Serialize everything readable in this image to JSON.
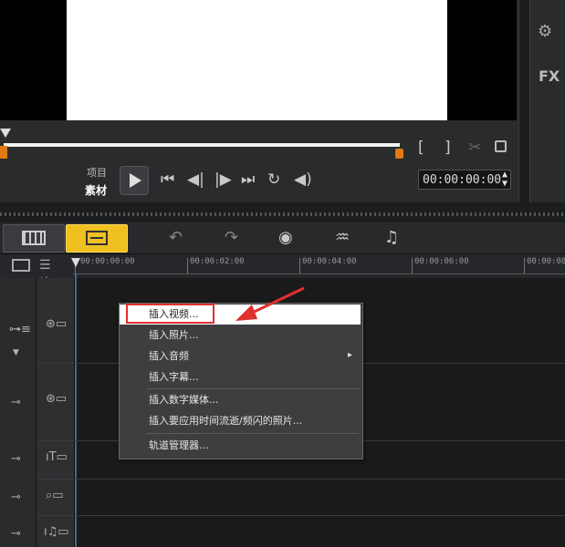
{
  "player": {
    "mode_project": "项目",
    "mode_clip": "素材",
    "timecode": "00:00:00:00",
    "mark_in": "[",
    "mark_out": "]"
  },
  "right_panel": {
    "fx_label": "FX"
  },
  "ruler": {
    "labels": [
      "00:00:00:00",
      "00:00:02:00",
      "00:00:04:00",
      "00:00:06:00",
      "00:00:08"
    ],
    "add_remove": "+/−"
  },
  "context_menu": {
    "items": [
      {
        "label": "插入视频..."
      },
      {
        "label": "插入照片..."
      },
      {
        "label": "插入音频"
      },
      {
        "label": "插入字幕..."
      },
      {
        "label": "插入数字媒体..."
      },
      {
        "label": "插入要应用时间流逝/频闪的照片..."
      },
      {
        "label": "轨道管理器..."
      }
    ],
    "submenu_arrow": "▸"
  },
  "colors": {
    "accent": "#f0c020",
    "scrub_marker": "#e07a12",
    "highlight_box": "#e03030"
  }
}
